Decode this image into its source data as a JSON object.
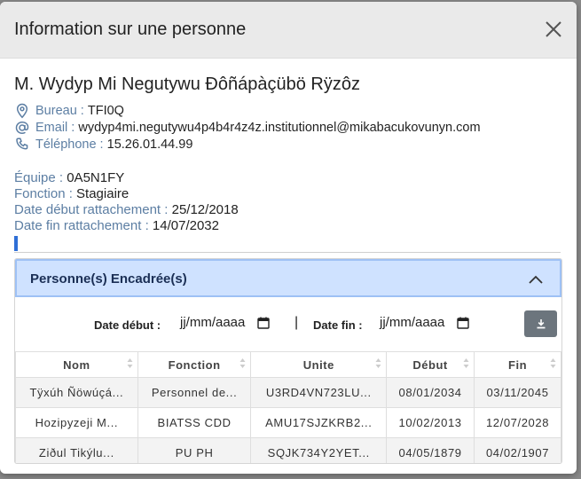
{
  "modal": {
    "title": "Information sur une personne"
  },
  "person": {
    "name": "M. Wydyp Mi Negutywu Ðôñápàçübö Rÿzôz",
    "bureau_label": "Bureau :",
    "bureau": "TFI0Q",
    "email_label": "Email :",
    "email": "wydyp4mi.negutywu4p4b4r4z4z.institutionnel@mikabacukovunyn.com",
    "tel_label": "Téléphone :",
    "tel": "15.26.01.44.99",
    "equipe_label": "Équipe :",
    "equipe": "0A5N1FY",
    "fonction_label": "Fonction :",
    "fonction": "Stagiaire",
    "debut_label": "Date début rattachement :",
    "debut": "25/12/2018",
    "fin_label": "Date fin rattachement :",
    "fin": "14/07/2032"
  },
  "section": {
    "title": "Personne(s) Encadrée(s)",
    "date_debut_label": "Date début :",
    "date_debut_placeholder": "jj/mm/aaaa",
    "separator": "|",
    "date_fin_label": "Date fin :",
    "date_fin_placeholder": "jj/mm/aaaa"
  },
  "table": {
    "headers": [
      "Nom",
      "Fonction",
      "Unite",
      "Début",
      "Fin"
    ],
    "rows": [
      [
        "Tÿxúh Ñöwúçá...",
        "Personnel de...",
        "U3RD4VN723LU...",
        "08/01/2034",
        "03/11/2045"
      ],
      [
        "Hozipyzeji M...",
        "BIATSS CDD",
        "AMU17SJZKRB2...",
        "10/02/2013",
        "12/07/2028"
      ],
      [
        "Ziðul Tikýlu...",
        "PU PH",
        "SQJK734Y2YET...",
        "04/05/1879",
        "04/02/1907"
      ]
    ]
  },
  "colors": {
    "accent": "#2f6fd6",
    "label": "#5c7ea3",
    "accordion_bg": "#cfe2ff",
    "download_btn": "#6c757d"
  },
  "icons": [
    "close-icon",
    "location-pin-icon",
    "at-sign-icon",
    "phone-icon",
    "chevron-up-icon",
    "calendar-icon",
    "download-icon",
    "sort-icon"
  ]
}
